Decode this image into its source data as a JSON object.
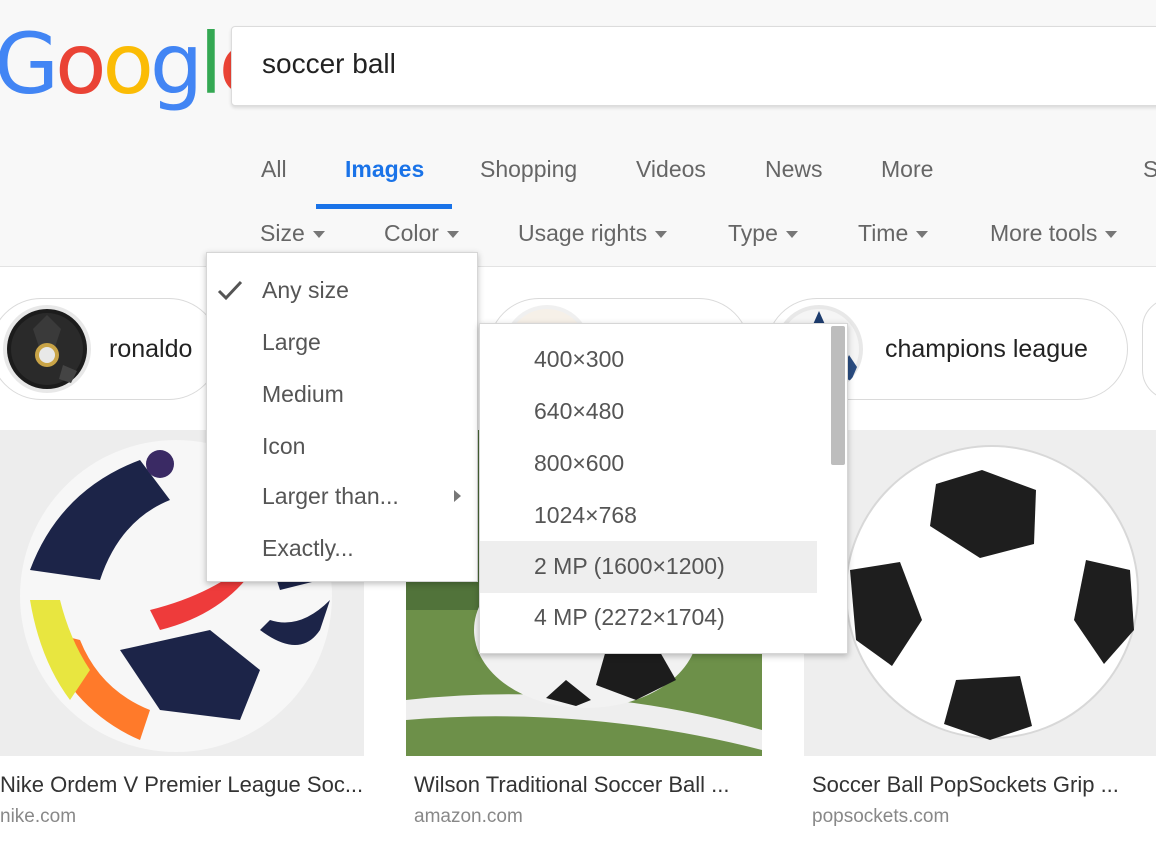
{
  "logo": {
    "letters": [
      "G",
      "o",
      "o",
      "g",
      "l",
      "e"
    ],
    "colors": [
      "#4285F4",
      "#EA4335",
      "#FBBC05",
      "#4285F4",
      "#34A853",
      "#EA4335"
    ]
  },
  "search": {
    "value": "soccer ball"
  },
  "tabs": [
    {
      "label": "All",
      "active": false
    },
    {
      "label": "Images",
      "active": true
    },
    {
      "label": "Shopping",
      "active": false
    },
    {
      "label": "Videos",
      "active": false
    },
    {
      "label": "News",
      "active": false
    },
    {
      "label": "More",
      "active": false
    },
    {
      "label": "S",
      "active": false
    }
  ],
  "tools": [
    {
      "label": "Size"
    },
    {
      "label": "Color"
    },
    {
      "label": "Usage rights"
    },
    {
      "label": "Type"
    },
    {
      "label": "Time"
    },
    {
      "label": "More tools"
    }
  ],
  "chips": [
    {
      "label": "ronaldo",
      "thumb": "real-madrid-ball"
    },
    {
      "label": "",
      "thumb": "spain-ball"
    },
    {
      "label": "champions league",
      "thumb": "champions-league-ball"
    }
  ],
  "results": [
    {
      "title": "Nike Ordem V Premier League Soc...",
      "source": "nike.com"
    },
    {
      "title": "Wilson Traditional Soccer Ball ...",
      "source": "amazon.com"
    },
    {
      "title": "Soccer Ball PopSockets Grip ...",
      "source": "popsockets.com"
    }
  ],
  "size_menu": {
    "items": [
      {
        "label": "Any size",
        "selected": true
      },
      {
        "label": "Large"
      },
      {
        "label": "Medium"
      },
      {
        "label": "Icon"
      },
      {
        "label": "Larger than...",
        "has_submenu": true
      },
      {
        "label": "Exactly..."
      }
    ]
  },
  "larger_than_submenu": {
    "items": [
      {
        "label": "400×300"
      },
      {
        "label": "640×480"
      },
      {
        "label": "800×600"
      },
      {
        "label": "1024×768"
      },
      {
        "label": "2 MP (1600×1200)",
        "hovered": true
      },
      {
        "label": "4 MP (2272×1704)"
      }
    ]
  },
  "colors": {
    "accent": "#1a73e8",
    "text_muted": "#666666"
  }
}
